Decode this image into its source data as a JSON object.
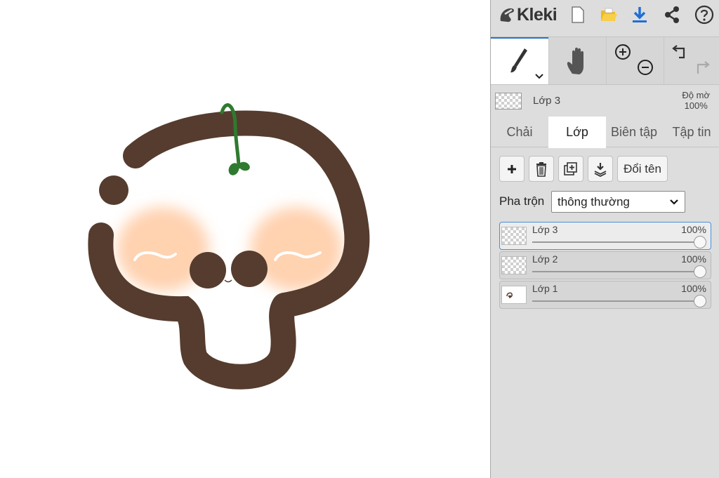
{
  "app": {
    "name": "Kleki"
  },
  "toolbar": {
    "items": [
      "new-file",
      "open-file",
      "download",
      "share",
      "help"
    ]
  },
  "active_layer": {
    "name": "Lớp 3",
    "opacity_label": "Độ mờ",
    "opacity_value": "100%"
  },
  "tabs": [
    {
      "label": "Chải",
      "active": false
    },
    {
      "label": "Lớp",
      "active": true
    },
    {
      "label": "Biên tập",
      "active": false
    },
    {
      "label": "Tập tin",
      "active": false
    }
  ],
  "layer_panel": {
    "rename_label": "Đổi tên",
    "blend_label": "Pha trộn",
    "blend_value": "thông thường",
    "layers": [
      {
        "name": "Lớp 3",
        "opacity": "100%",
        "selected": true
      },
      {
        "name": "Lớp 2",
        "opacity": "100%",
        "selected": false
      },
      {
        "name": "Lớp 1",
        "opacity": "100%",
        "selected": false
      }
    ]
  },
  "colors": {
    "accent": "#2a73c9",
    "folder": "#f2b91c",
    "download": "#1f6fd6",
    "drawing_brown": "#553c2e",
    "drawing_blush": "#ffd2b0",
    "drawing_sprout": "#2f7a2f"
  },
  "icons": [
    "kleki-logo-icon",
    "new-file-icon",
    "open-folder-icon",
    "download-icon",
    "share-icon",
    "help-icon",
    "brush-icon",
    "hand-icon",
    "zoom-in-icon",
    "zoom-out-icon",
    "undo-icon",
    "redo-icon",
    "plus-icon",
    "trash-icon",
    "duplicate-icon",
    "merge-down-icon",
    "chevron-down-icon"
  ]
}
